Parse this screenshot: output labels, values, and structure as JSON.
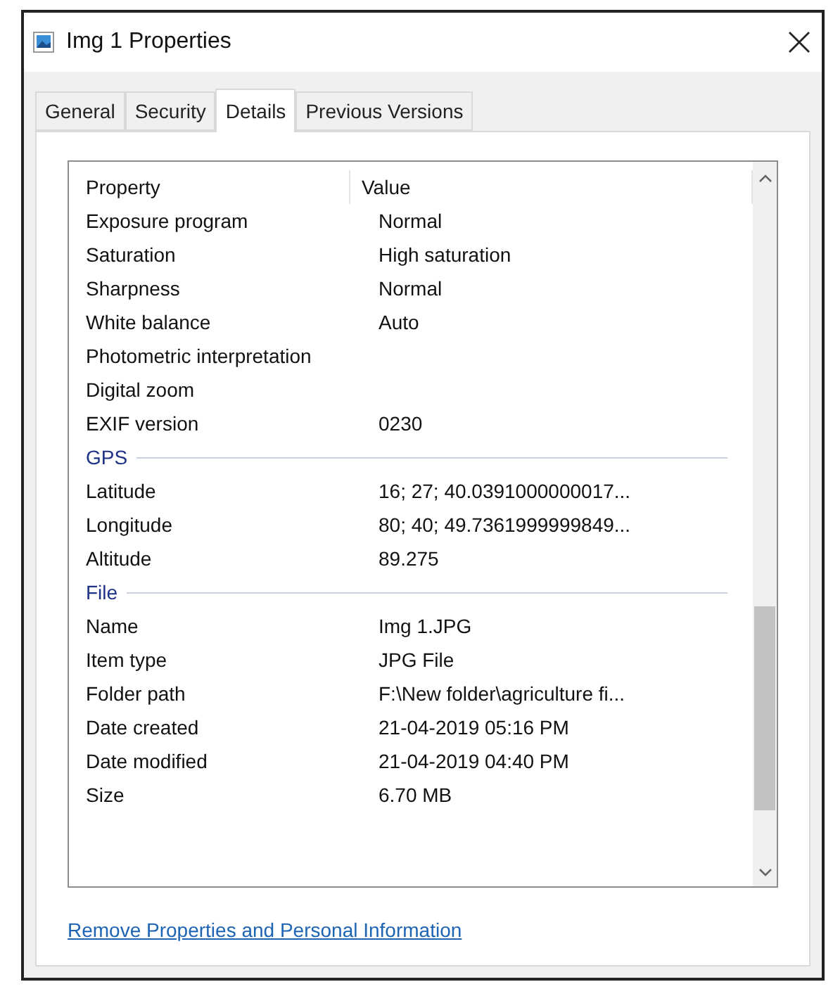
{
  "window": {
    "title": "Img 1 Properties"
  },
  "tabs": [
    {
      "label": "General",
      "selected": false
    },
    {
      "label": "Security",
      "selected": false
    },
    {
      "label": "Details",
      "selected": true
    },
    {
      "label": "Previous Versions",
      "selected": false
    }
  ],
  "details": {
    "columns": [
      "Property",
      "Value"
    ],
    "rows": [
      {
        "kind": "row",
        "property": "Exposure program",
        "value": "Normal"
      },
      {
        "kind": "row",
        "property": "Saturation",
        "value": "High saturation"
      },
      {
        "kind": "row",
        "property": "Sharpness",
        "value": "Normal"
      },
      {
        "kind": "row",
        "property": "White balance",
        "value": "Auto"
      },
      {
        "kind": "row",
        "property": "Photometric interpretation",
        "value": ""
      },
      {
        "kind": "row",
        "property": "Digital zoom",
        "value": ""
      },
      {
        "kind": "row",
        "property": "EXIF version",
        "value": "0230"
      },
      {
        "kind": "group",
        "label": "GPS"
      },
      {
        "kind": "row",
        "property": "Latitude",
        "value": "16; 27; 40.0391000000017..."
      },
      {
        "kind": "row",
        "property": "Longitude",
        "value": "80; 40; 49.7361999999849..."
      },
      {
        "kind": "row",
        "property": "Altitude",
        "value": "89.275"
      },
      {
        "kind": "group",
        "label": "File"
      },
      {
        "kind": "row",
        "property": "Name",
        "value": "Img 1.JPG"
      },
      {
        "kind": "row",
        "property": "Item type",
        "value": "JPG File"
      },
      {
        "kind": "row",
        "property": "Folder path",
        "value": "F:\\New folder\\agriculture fi..."
      },
      {
        "kind": "row",
        "property": "Date created",
        "value": "21-04-2019 05:16 PM"
      },
      {
        "kind": "row",
        "property": "Date modified",
        "value": "21-04-2019 04:40 PM"
      },
      {
        "kind": "row",
        "property": "Size",
        "value": "6.70 MB"
      }
    ]
  },
  "link": "Remove Properties and Personal Information"
}
